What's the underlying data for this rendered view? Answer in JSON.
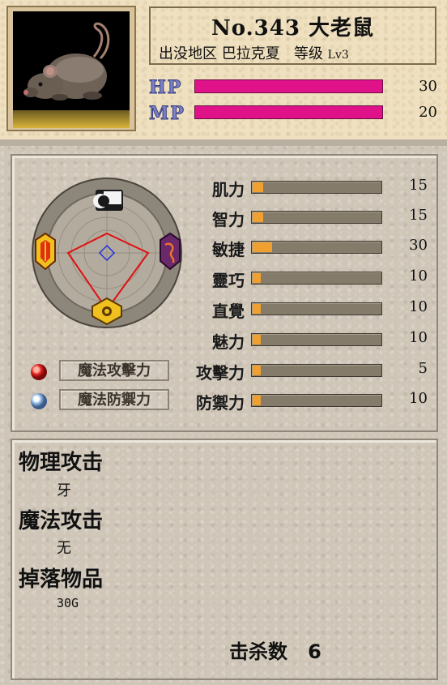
{
  "monster": {
    "title": "No.343 大老鼠",
    "area_label": "出没地区",
    "area": "巴拉克夏",
    "level_label": "等级",
    "level": "Lv3",
    "portrait": "rat-portrait"
  },
  "vitals": {
    "hp_label": "HP",
    "hp_value": "30",
    "hp_fill": 1.0,
    "mp_label": "MP",
    "mp_value": "20",
    "mp_fill": 1.0
  },
  "stats": [
    {
      "label": "肌力",
      "value": "15",
      "fill": 0.08
    },
    {
      "label": "智力",
      "value": "15",
      "fill": 0.08
    },
    {
      "label": "敏捷",
      "value": "30",
      "fill": 0.15
    },
    {
      "label": "靈巧",
      "value": "10",
      "fill": 0.05
    },
    {
      "label": "直覺",
      "value": "10",
      "fill": 0.05
    },
    {
      "label": "魅力",
      "value": "10",
      "fill": 0.05
    },
    {
      "label": "攻擊力",
      "value": "5",
      "fill": 0.025
    },
    {
      "label": "防禦力",
      "value": "10",
      "fill": 0.05
    }
  ],
  "magic_buttons": {
    "attack": "魔法攻擊力",
    "defense": "魔法防禦力"
  },
  "info": {
    "physical_attack_label": "物理攻击",
    "physical_attack": "牙",
    "magic_attack_label": "魔法攻击",
    "magic_attack": "无",
    "drops_label": "掉落物品",
    "drops": "30G"
  },
  "kills": {
    "label": "击杀数",
    "value": "6"
  },
  "colors": {
    "hp_bar": "#e0128a",
    "stat_fill": "#f0a030",
    "wheel_polygon": "#e01010",
    "wheel_inner": "#2030e0"
  },
  "icons": [
    "rat-portrait",
    "moon-element-icon",
    "fire-element-icon",
    "water-element-icon",
    "earth-element-icon",
    "red-orb-icon",
    "blue-orb-icon"
  ]
}
